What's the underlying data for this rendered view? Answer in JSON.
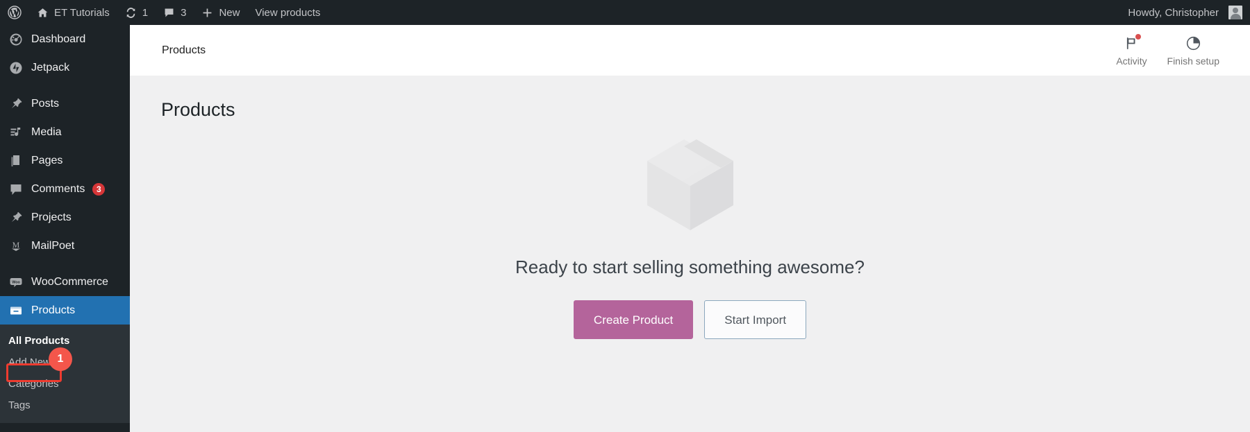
{
  "adminbar": {
    "wp_logo": "wordpress-logo",
    "site_name": "ET Tutorials",
    "updates_count": "1",
    "comments_count": "3",
    "new_label": "New",
    "view_products_label": "View products",
    "howdy": "Howdy, Christopher"
  },
  "sidebar": {
    "items": [
      {
        "label": "Dashboard",
        "icon": "dashboard-icon",
        "badge": ""
      },
      {
        "label": "Jetpack",
        "icon": "jetpack-icon",
        "badge": ""
      },
      {
        "label": "Posts",
        "icon": "pin-icon",
        "badge": ""
      },
      {
        "label": "Media",
        "icon": "media-icon",
        "badge": ""
      },
      {
        "label": "Pages",
        "icon": "pages-icon",
        "badge": ""
      },
      {
        "label": "Comments",
        "icon": "comment-icon",
        "badge": "3"
      },
      {
        "label": "Projects",
        "icon": "pin-icon",
        "badge": ""
      },
      {
        "label": "MailPoet",
        "icon": "mailpoet-icon",
        "badge": ""
      },
      {
        "label": "WooCommerce",
        "icon": "woocommerce-icon",
        "badge": ""
      },
      {
        "label": "Products",
        "icon": "products-icon",
        "badge": ""
      }
    ],
    "submenu": [
      {
        "label": "All Products",
        "current": true
      },
      {
        "label": "Add New",
        "current": false
      },
      {
        "label": "Categories",
        "current": false
      },
      {
        "label": "Tags",
        "current": false
      }
    ]
  },
  "annotation": {
    "step_number": "1",
    "highlight_target": "Add New",
    "badge_color": "#f4564b",
    "outline_color": "#ee3b2f"
  },
  "header": {
    "breadcrumb": "Products",
    "activity_label": "Activity",
    "activity_icon": "flag-icon",
    "finish_setup_label": "Finish setup",
    "finish_setup_icon": "progress-circle-icon"
  },
  "page": {
    "title": "Products",
    "illustration": "package-box-icon",
    "headline": "Ready to start selling something awesome?",
    "primary_button": "Create Product",
    "secondary_button": "Start Import",
    "primary_color": "#b4649b",
    "secondary_border_color": "#8ba7bd"
  }
}
